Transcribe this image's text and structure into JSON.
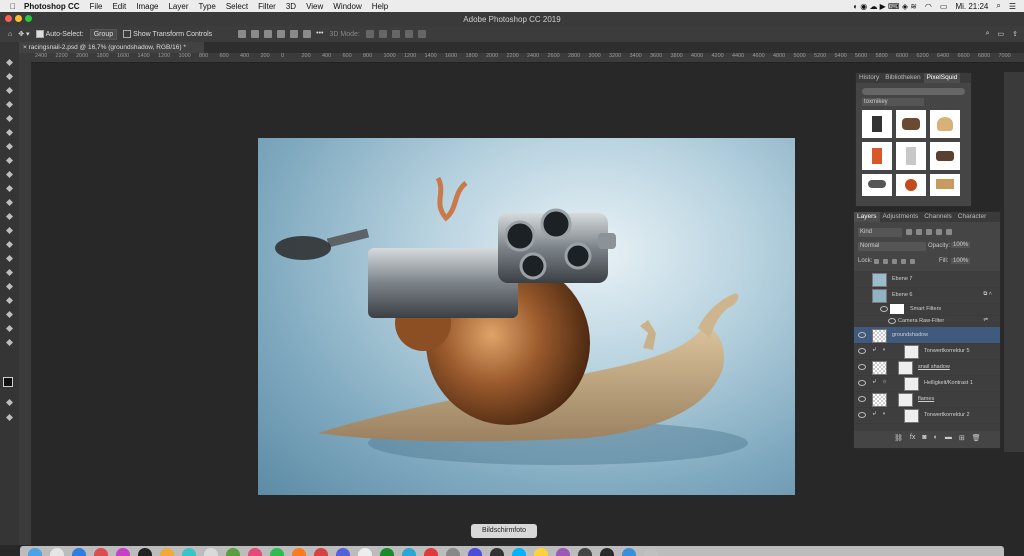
{
  "menubar": {
    "app_name": "Photoshop CC",
    "items": [
      "File",
      "Edit",
      "Image",
      "Layer",
      "Type",
      "Select",
      "Filter",
      "3D",
      "View",
      "Window",
      "Help"
    ],
    "clock": "Mi. 21:24"
  },
  "window": {
    "title": "Adobe Photoshop CC 2019"
  },
  "options": {
    "auto_select_label": "Auto-Select:",
    "auto_select_value": "Group",
    "transform_label": "Show Transform Controls",
    "mode_label": "3D Mode:"
  },
  "document": {
    "tab_label": "racingsnail-2.psd @ 16,7% (groundshadow, RGB/16) *"
  },
  "ruler": {
    "ticks": [
      "2400",
      "2200",
      "2000",
      "1800",
      "1600",
      "1400",
      "1200",
      "1000",
      "800",
      "600",
      "400",
      "200",
      "0",
      "200",
      "400",
      "600",
      "800",
      "1000",
      "1200",
      "1400",
      "1600",
      "1800",
      "2000",
      "2200",
      "2400",
      "2600",
      "2800",
      "3000",
      "3200",
      "3400",
      "3600",
      "3800",
      "4000",
      "4200",
      "4400",
      "4600",
      "4800",
      "5000",
      "5200",
      "5400",
      "5600",
      "5800",
      "6000",
      "6200",
      "6400",
      "6600",
      "6800",
      "7000"
    ]
  },
  "pixelsquid": {
    "tabs": [
      "History",
      "Bibliotheken",
      "PixelSquid"
    ],
    "active_tab": "PixelSquid",
    "collection": "toxmikey"
  },
  "layers_panel": {
    "tabs": [
      "Layers",
      "Adjustments",
      "Channels",
      "Character"
    ],
    "active_tab": "Layers",
    "kind_label": "Kind",
    "blend_mode": "Normal",
    "opacity_label": "Opacity:",
    "opacity_value": "100%",
    "lock_label": "Lock:",
    "fill_label": "Fill:",
    "fill_value": "100%",
    "layers": [
      {
        "name": "Ebene 7",
        "visible": false
      },
      {
        "name": "Ebene 6",
        "visible": false
      },
      {
        "name": "Smart Filters",
        "visible": true
      },
      {
        "name": "Camera Raw-Filter",
        "visible": true
      },
      {
        "name": "groundshadow",
        "visible": true,
        "selected": true
      },
      {
        "name": "Tonwertkorrektur 5",
        "visible": true
      },
      {
        "name": "snail shadow",
        "visible": true
      },
      {
        "name": "Helligkeit/Kontrast 1",
        "visible": true
      },
      {
        "name": "flames",
        "visible": true
      },
      {
        "name": "Tonwertkorrektur 2",
        "visible": true
      }
    ]
  },
  "tooltip": "Bildschirmfoto",
  "colors": {
    "selection": "#3f5a7c",
    "panel": "#454545",
    "menubar": "#ececec"
  }
}
